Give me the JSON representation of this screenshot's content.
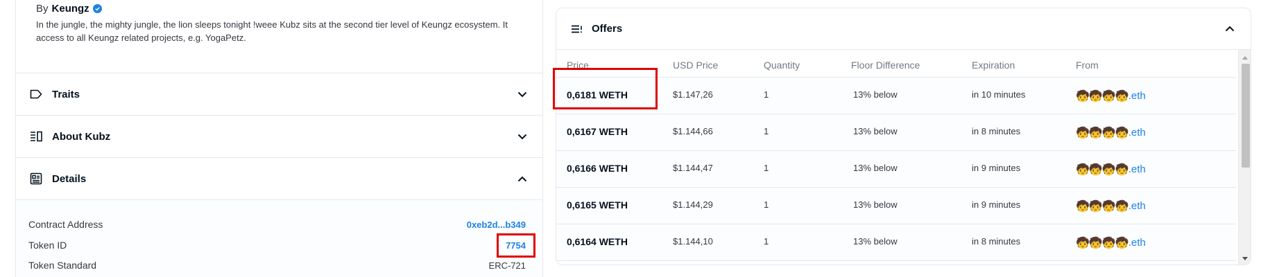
{
  "collection": {
    "by_label": "By",
    "creator": "Keungz",
    "description": "In the jungle, the mighty jungle, the lion sleeps tonight !weee Kubz sits at the second tier level of Keungz ecosystem. It access to all Keungz related projects, e.g. YogaPetz."
  },
  "sections": {
    "traits": "Traits",
    "about": "About Kubz",
    "details": "Details"
  },
  "details": {
    "contract_label": "Contract Address",
    "contract_value": "0xeb2d...b349",
    "token_id_label": "Token ID",
    "token_id_value": "7754",
    "standard_label": "Token Standard",
    "standard_value": "ERC-721"
  },
  "offers": {
    "title": "Offers",
    "columns": [
      "Price",
      "USD Price",
      "Quantity",
      "Floor Difference",
      "Expiration",
      "From"
    ],
    "rows": [
      {
        "price": "0,6181 WETH",
        "usd": "$1.147,26",
        "qty": "1",
        "floor": "13% below",
        "exp": "in 10 minutes",
        "from_emoji": "🧒🧒🧒🧒",
        "from_suffix": ".eth"
      },
      {
        "price": "0,6167 WETH",
        "usd": "$1.144,66",
        "qty": "1",
        "floor": "13% below",
        "exp": "in 8 minutes",
        "from_emoji": "🧒🧒🧒🧒",
        "from_suffix": ".eth"
      },
      {
        "price": "0,6166 WETH",
        "usd": "$1.144,47",
        "qty": "1",
        "floor": "13% below",
        "exp": "in 9 minutes",
        "from_emoji": "🧒🧒🧒🧒",
        "from_suffix": ".eth"
      },
      {
        "price": "0,6165 WETH",
        "usd": "$1.144,29",
        "qty": "1",
        "floor": "13% below",
        "exp": "in 9 minutes",
        "from_emoji": "🧒🧒🧒🧒",
        "from_suffix": ".eth"
      },
      {
        "price": "0,6164 WETH",
        "usd": "$1.144,10",
        "qty": "1",
        "floor": "13% below",
        "exp": "in 8 minutes",
        "from_emoji": "🧒🧒🧒🧒",
        "from_suffix": ".eth"
      }
    ]
  },
  "colors": {
    "link": "#2081e2",
    "highlight": "#e00000",
    "text_primary": "#04111d",
    "text_secondary": "#707a83"
  },
  "icons": {
    "verified": "verified-badge-icon",
    "traits": "tag-icon",
    "about": "list-detail-icon",
    "details": "id-card-icon",
    "offers": "list-lines-icon",
    "expand": "chevron-down-icon",
    "collapse": "chevron-up-icon"
  }
}
